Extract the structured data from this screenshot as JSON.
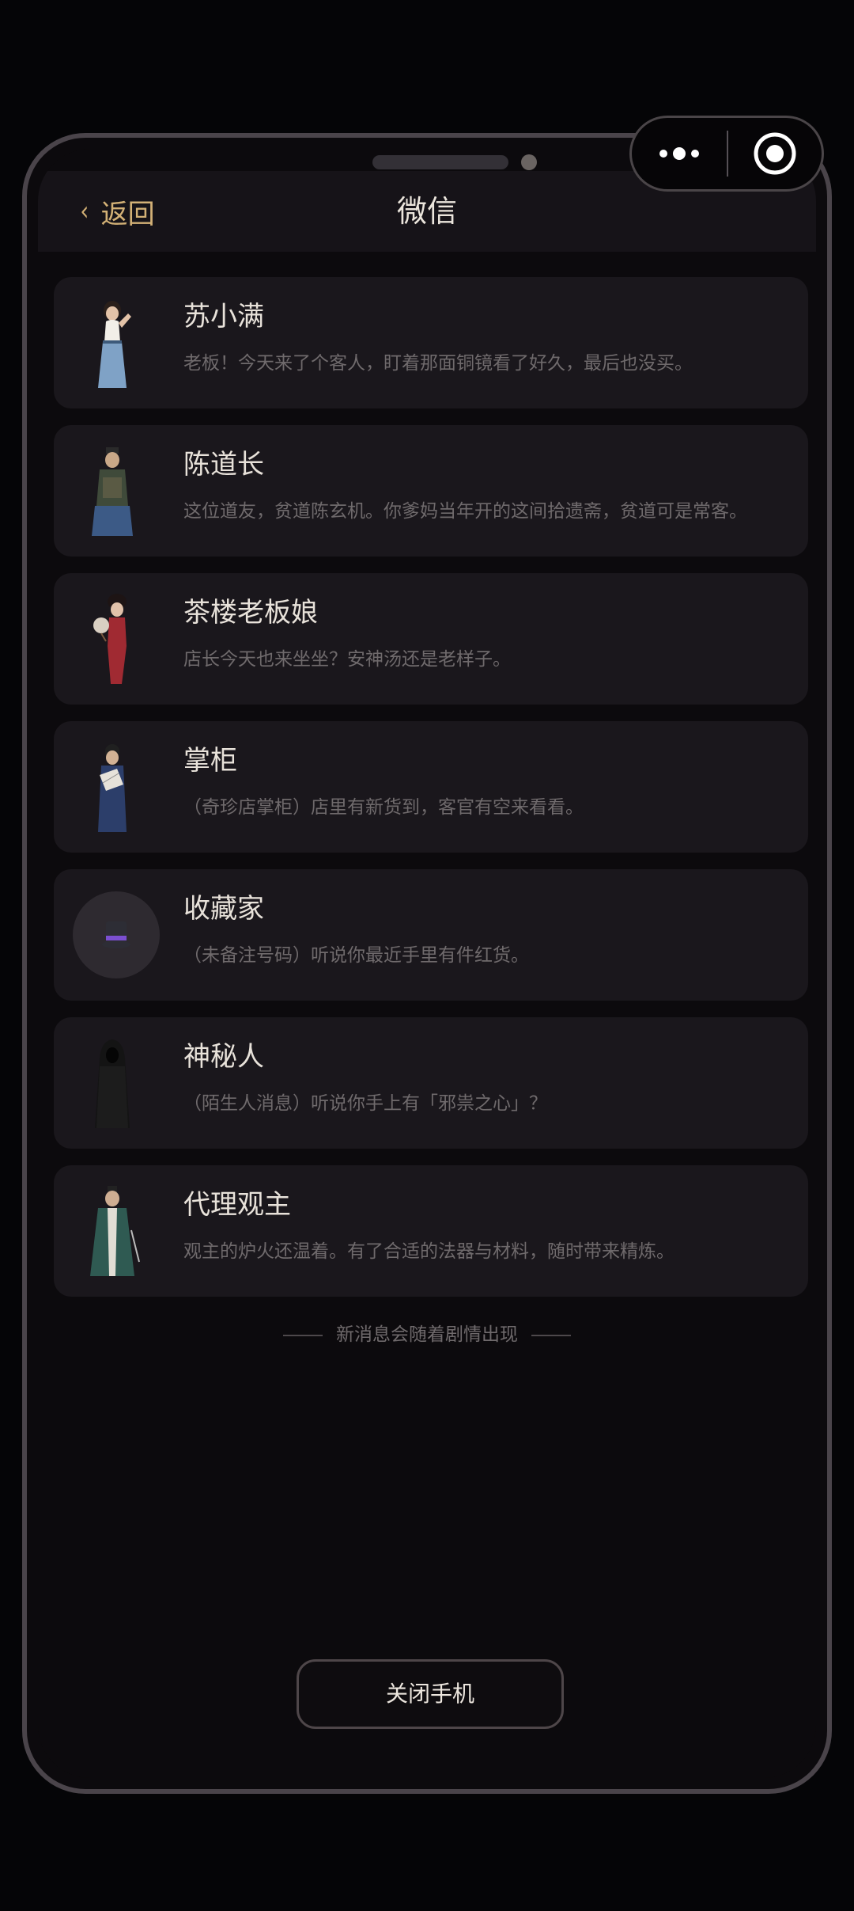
{
  "header": {
    "back_label": "返回",
    "title": "微信"
  },
  "contacts": [
    {
      "name": "苏小满",
      "preview": "老板！今天来了个客人，盯着那面铜镜看了好久，最后也没买。",
      "avatar": "girl-avatar"
    },
    {
      "name": "陈道长",
      "preview": "这位道友，贫道陈玄机。你爹妈当年开的这间拾遗斋，贫道可是常客。",
      "avatar": "taoist-avatar"
    },
    {
      "name": "茶楼老板娘",
      "preview": "店长今天也来坐坐？安神汤还是老样子。",
      "avatar": "lady-avatar"
    },
    {
      "name": "掌柜",
      "preview": "（奇珍店掌柜）店里有新货到，客官有空来看看。",
      "avatar": "shopkeeper-avatar"
    },
    {
      "name": "收藏家",
      "preview": "（未备注号码）听说你最近手里有件红货。",
      "avatar": "top-hat-icon"
    },
    {
      "name": "神秘人",
      "preview": "（陌生人消息）听说你手上有「邪祟之心」？",
      "avatar": "hooded-figure-avatar"
    },
    {
      "name": "代理观主",
      "preview": "观主的炉火还温着。有了合适的法器与材料，随时带来精炼。",
      "avatar": "abbot-avatar"
    }
  ],
  "footer_hint": "新消息会随着剧情出现",
  "close_button_label": "关闭手机",
  "colors": {
    "accent_gold": "#d3b176",
    "card_bg": "#1a171c",
    "page_bg": "#0c0a0d"
  }
}
